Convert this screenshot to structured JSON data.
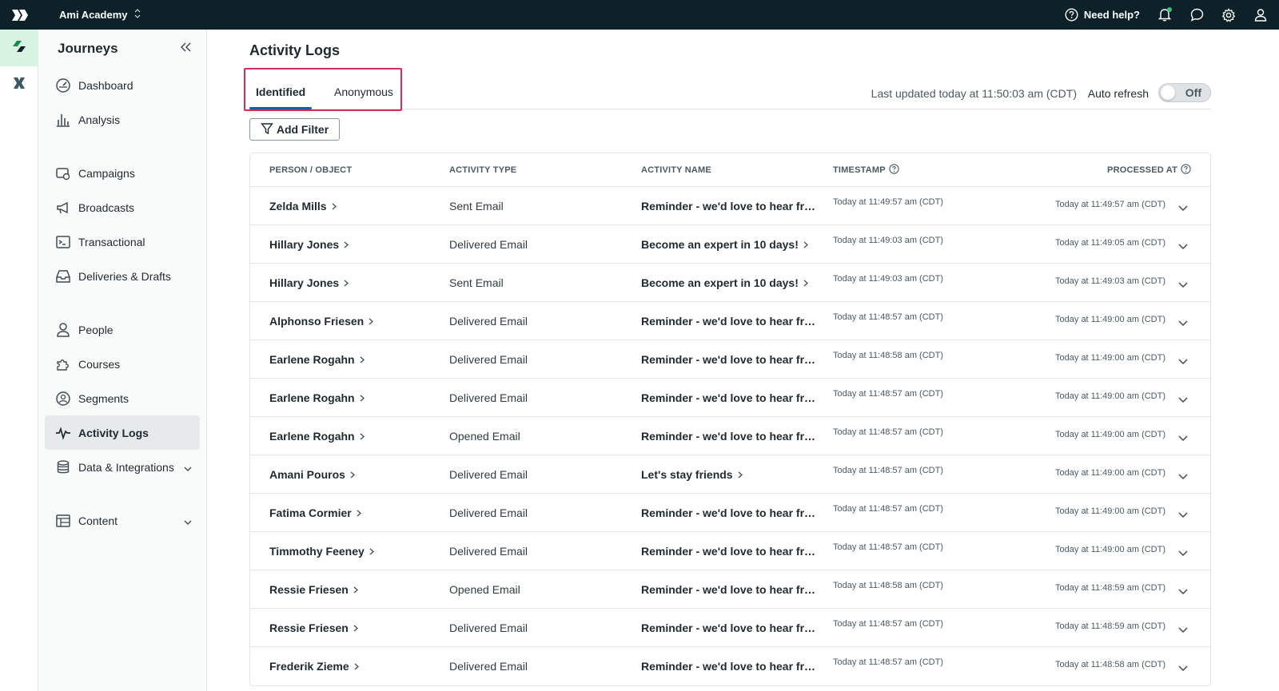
{
  "topbar": {
    "workspace": "Ami Academy",
    "help_label": "Need help?",
    "icons": [
      "help-icon",
      "bell-icon",
      "chat-icon",
      "gear-icon",
      "user-icon"
    ]
  },
  "sidebar": {
    "title": "Journeys",
    "items": [
      {
        "label": "Dashboard",
        "icon": "dashboard-icon"
      },
      {
        "label": "Analysis",
        "icon": "bar-chart-icon"
      },
      {
        "label": "Campaigns",
        "icon": "campaigns-icon"
      },
      {
        "label": "Broadcasts",
        "icon": "megaphone-icon"
      },
      {
        "label": "Transactional",
        "icon": "terminal-icon"
      },
      {
        "label": "Deliveries & Drafts",
        "icon": "inbox-icon"
      },
      {
        "label": "People",
        "icon": "person-icon"
      },
      {
        "label": "Courses",
        "icon": "puzzle-icon"
      },
      {
        "label": "Segments",
        "icon": "segments-icon"
      },
      {
        "label": "Activity Logs",
        "icon": "pulse-icon"
      },
      {
        "label": "Data & Integrations",
        "icon": "database-icon"
      },
      {
        "label": "Content",
        "icon": "table-icon"
      }
    ]
  },
  "main": {
    "title": "Activity Logs",
    "tabs": [
      {
        "label": "Identified"
      },
      {
        "label": "Anonymous"
      }
    ],
    "last_updated": "Last updated today at 11:50:03 am (CDT)",
    "auto_refresh_label": "Auto refresh",
    "toggle_state": "Off",
    "add_filter_label": "Add Filter",
    "columns": {
      "person": "PERSON / OBJECT",
      "type": "ACTIVITY TYPE",
      "name": "ACTIVITY NAME",
      "timestamp": "TIMESTAMP",
      "processed": "PROCESSED AT"
    },
    "rows": [
      {
        "person": "Zelda Mills",
        "type": "Sent Email",
        "name": "Reminder - we'd love to hear from you",
        "timestamp": "Today at 11:49:57 am (CDT)",
        "processed": "Today at 11:49:57 am (CDT)"
      },
      {
        "person": "Hillary Jones",
        "type": "Delivered Email",
        "name": "Become an expert in 10 days!",
        "timestamp": "Today at 11:49:03 am (CDT)",
        "processed": "Today at 11:49:05 am (CDT)"
      },
      {
        "person": "Hillary Jones",
        "type": "Sent Email",
        "name": "Become an expert in 10 days!",
        "timestamp": "Today at 11:49:03 am (CDT)",
        "processed": "Today at 11:49:03 am (CDT)"
      },
      {
        "person": "Alphonso Friesen",
        "type": "Delivered Email",
        "name": "Reminder - we'd love to hear from you",
        "timestamp": "Today at 11:48:57 am (CDT)",
        "processed": "Today at 11:49:00 am (CDT)"
      },
      {
        "person": "Earlene Rogahn",
        "type": "Delivered Email",
        "name": "Reminder - we'd love to hear from you",
        "timestamp": "Today at 11:48:58 am (CDT)",
        "processed": "Today at 11:49:00 am (CDT)"
      },
      {
        "person": "Earlene Rogahn",
        "type": "Delivered Email",
        "name": "Reminder - we'd love to hear from you",
        "timestamp": "Today at 11:48:57 am (CDT)",
        "processed": "Today at 11:49:00 am (CDT)"
      },
      {
        "person": "Earlene Rogahn",
        "type": "Opened Email",
        "name": "Reminder - we'd love to hear from you",
        "timestamp": "Today at 11:48:57 am (CDT)",
        "processed": "Today at 11:49:00 am (CDT)"
      },
      {
        "person": "Amani Pouros",
        "type": "Delivered Email",
        "name": "Let's stay friends",
        "timestamp": "Today at 11:48:57 am (CDT)",
        "processed": "Today at 11:49:00 am (CDT)"
      },
      {
        "person": "Fatima Cormier",
        "type": "Delivered Email",
        "name": "Reminder - we'd love to hear from you",
        "timestamp": "Today at 11:48:57 am (CDT)",
        "processed": "Today at 11:49:00 am (CDT)"
      },
      {
        "person": "Timmothy Feeney",
        "type": "Delivered Email",
        "name": "Reminder - we'd love to hear from you",
        "timestamp": "Today at 11:48:57 am (CDT)",
        "processed": "Today at 11:49:00 am (CDT)"
      },
      {
        "person": "Ressie Friesen",
        "type": "Opened Email",
        "name": "Reminder - we'd love to hear from you",
        "timestamp": "Today at 11:48:58 am (CDT)",
        "processed": "Today at 11:48:59 am (CDT)"
      },
      {
        "person": "Ressie Friesen",
        "type": "Delivered Email",
        "name": "Reminder - we'd love to hear from you",
        "timestamp": "Today at 11:48:57 am (CDT)",
        "processed": "Today at 11:48:59 am (CDT)"
      },
      {
        "person": "Frederik Zieme",
        "type": "Delivered Email",
        "name": "Reminder - we'd love to hear from you",
        "timestamp": "Today at 11:48:57 am (CDT)",
        "processed": "Today at 11:48:58 am (CDT)"
      }
    ]
  },
  "colors": {
    "topbar": "#0d2129",
    "accent_green": "#1c8a4f",
    "tab_underline": "#1f5aa8",
    "highlight": "#d62b54"
  }
}
